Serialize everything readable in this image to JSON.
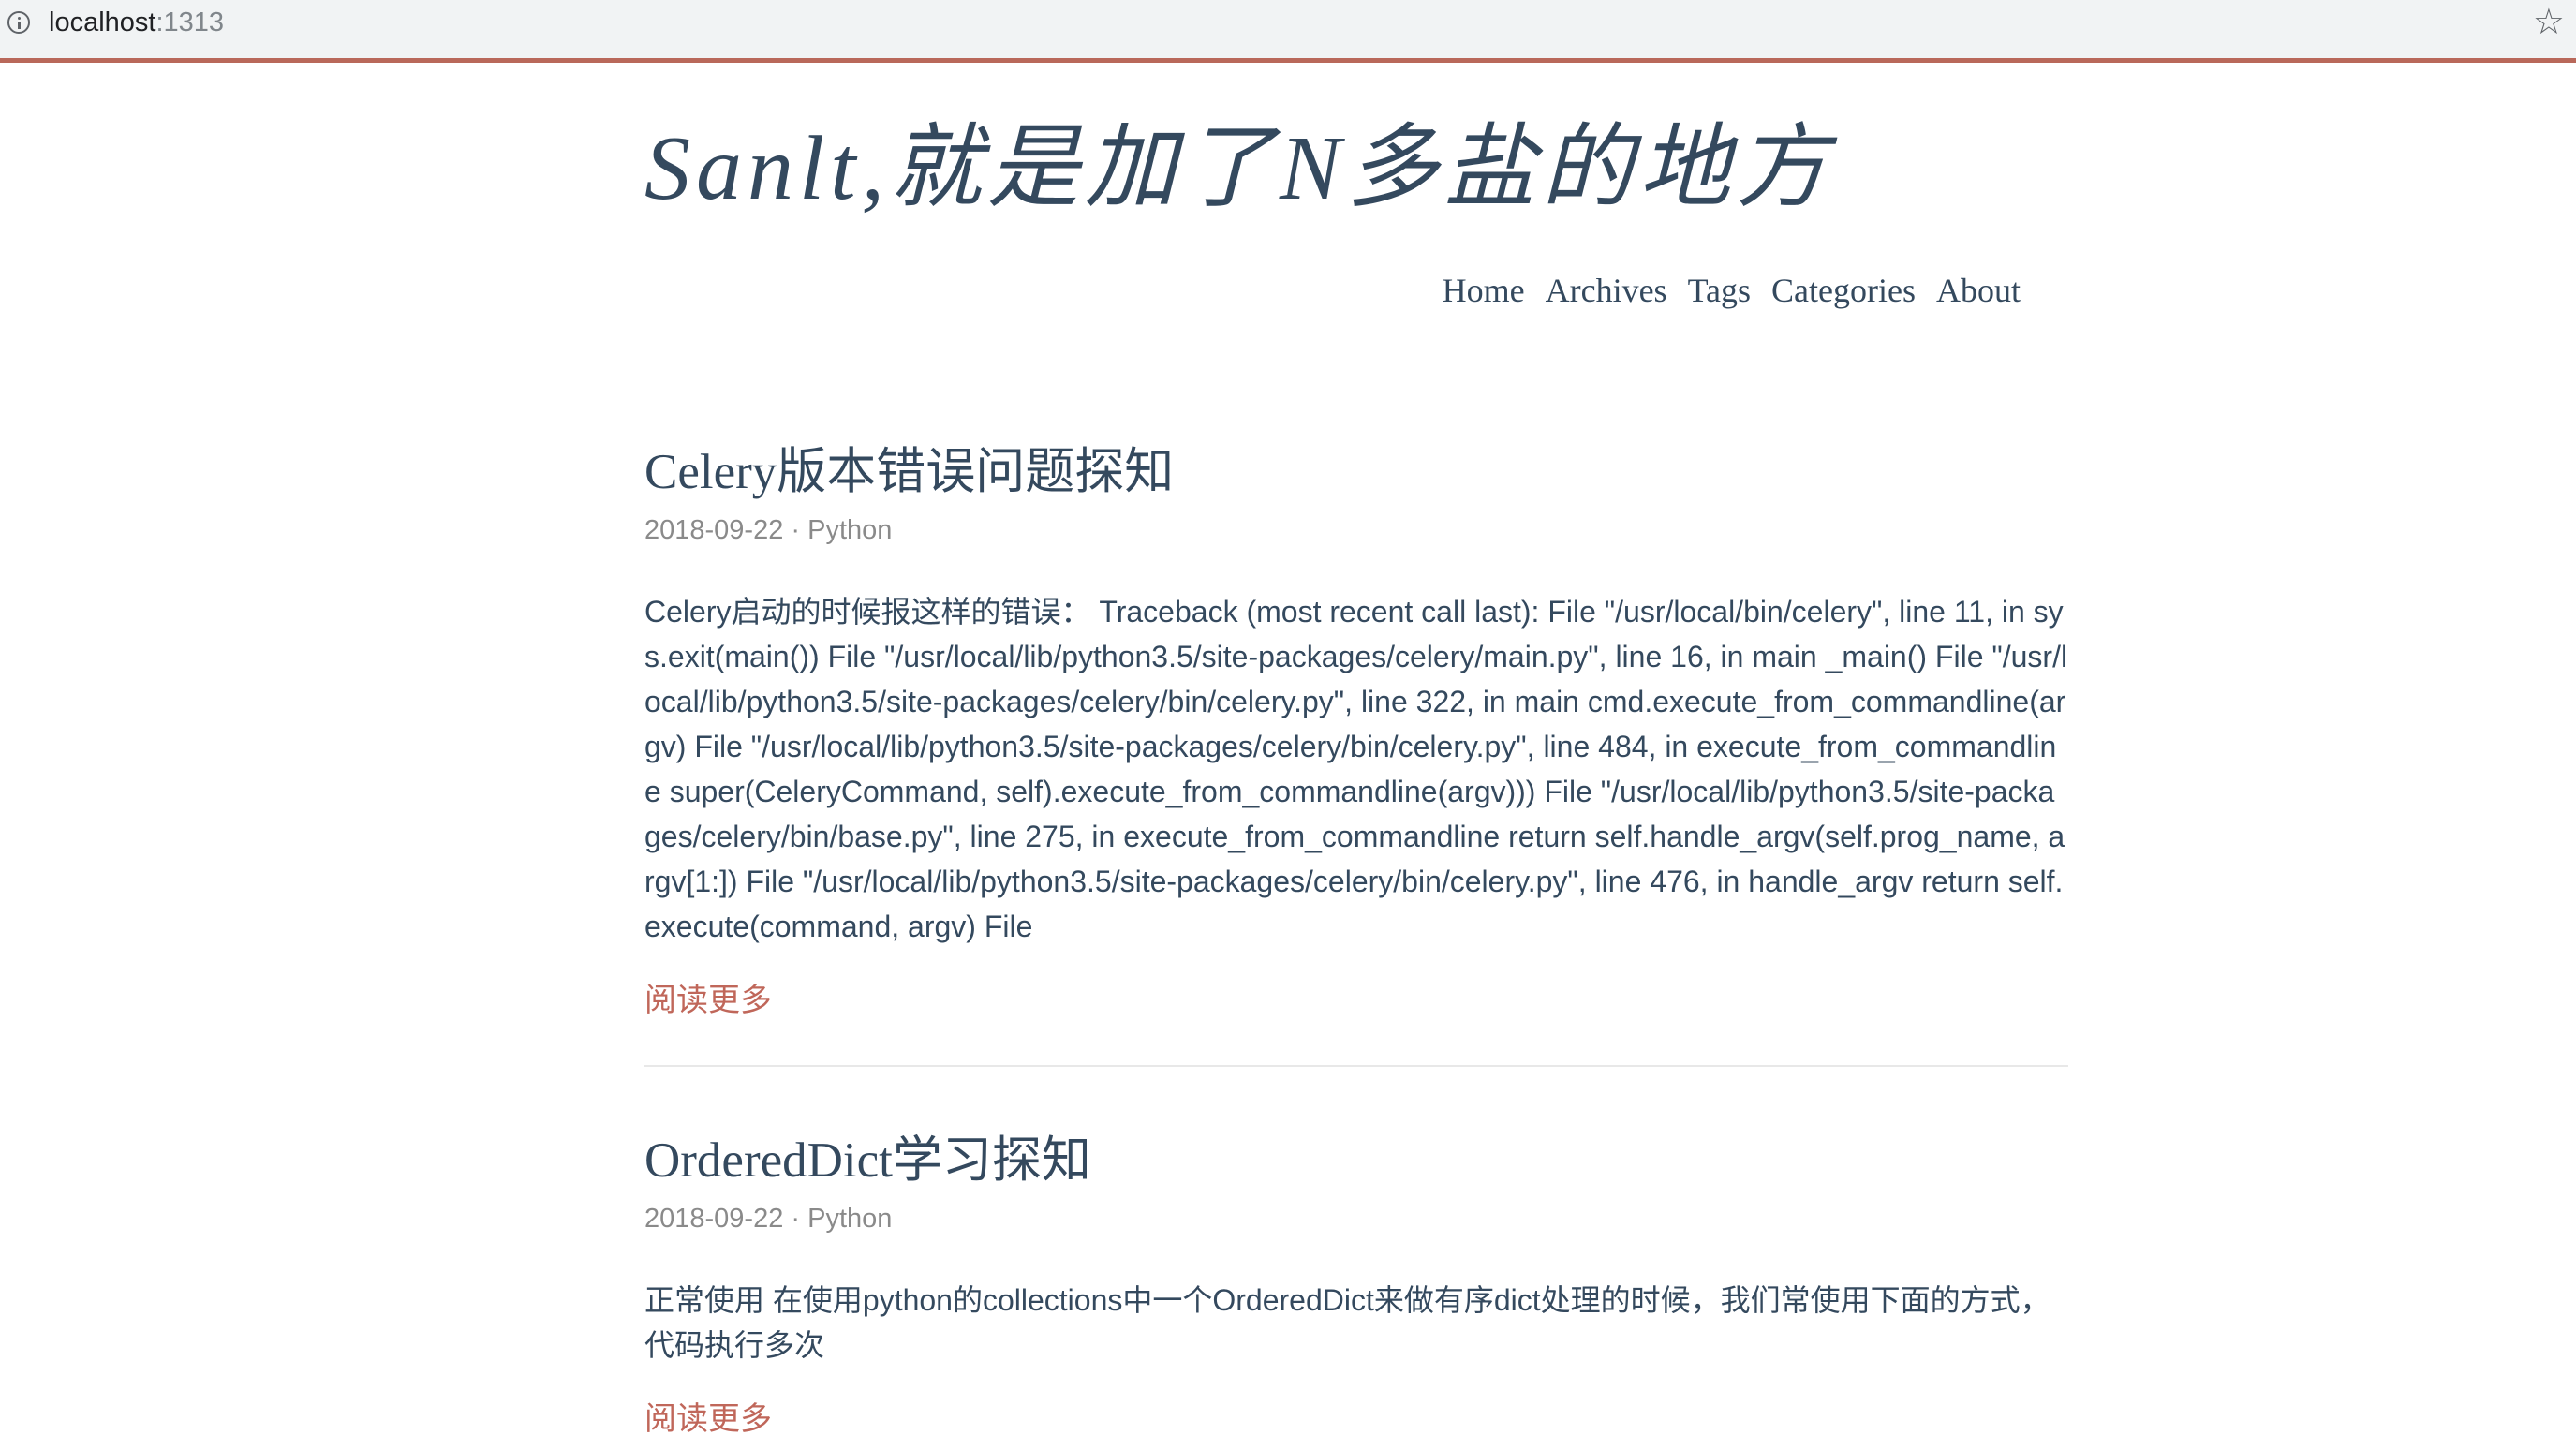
{
  "browser": {
    "url_host": "localhost",
    "url_port": ":1313",
    "icons": {
      "info": "info-icon",
      "bookmark": "star-icon"
    },
    "accent_color": "#b9685a"
  },
  "site": {
    "title": "Sanlt,就是加了N多盐的地方"
  },
  "nav": {
    "items": [
      "Home",
      "Archives",
      "Tags",
      "Categories",
      "About"
    ]
  },
  "posts": [
    {
      "title": "Celery版本错误问题探知",
      "meta": "2018-09-22 · Python",
      "summary": "Celery启动的时候报这样的错误：  Traceback (most recent call last): File \"/usr/local/bin/celery\", line 11, in sys.exit(main()) File \"/usr/local/lib/python3.5/site-packages/celery/main.py\", line 16, in main _main() File \"/usr/local/lib/python3.5/site-packages/celery/bin/celery.py\", line 322, in main cmd.execute_from_commandline(argv) File \"/usr/local/lib/python3.5/site-packages/celery/bin/celery.py\", line 484, in execute_from_commandline super(CeleryCommand, self).execute_from_commandline(argv))) File \"/usr/local/lib/python3.5/site-packages/celery/bin/base.py\", line 275, in execute_from_commandline return self.handle_argv(self.prog_name, argv[1:]) File \"/usr/local/lib/python3.5/site-packages/celery/bin/celery.py\", line 476, in handle_argv return self.execute(command, argv) File",
      "read_more": "阅读更多"
    },
    {
      "title": "OrderedDict学习探知",
      "meta": "2018-09-22 · Python",
      "summary": "正常使用 在使用python的collections中一个OrderedDict来做有序dict处理的时候，我们常使用下面的方式，代码执行多次",
      "read_more": "阅读更多"
    }
  ]
}
